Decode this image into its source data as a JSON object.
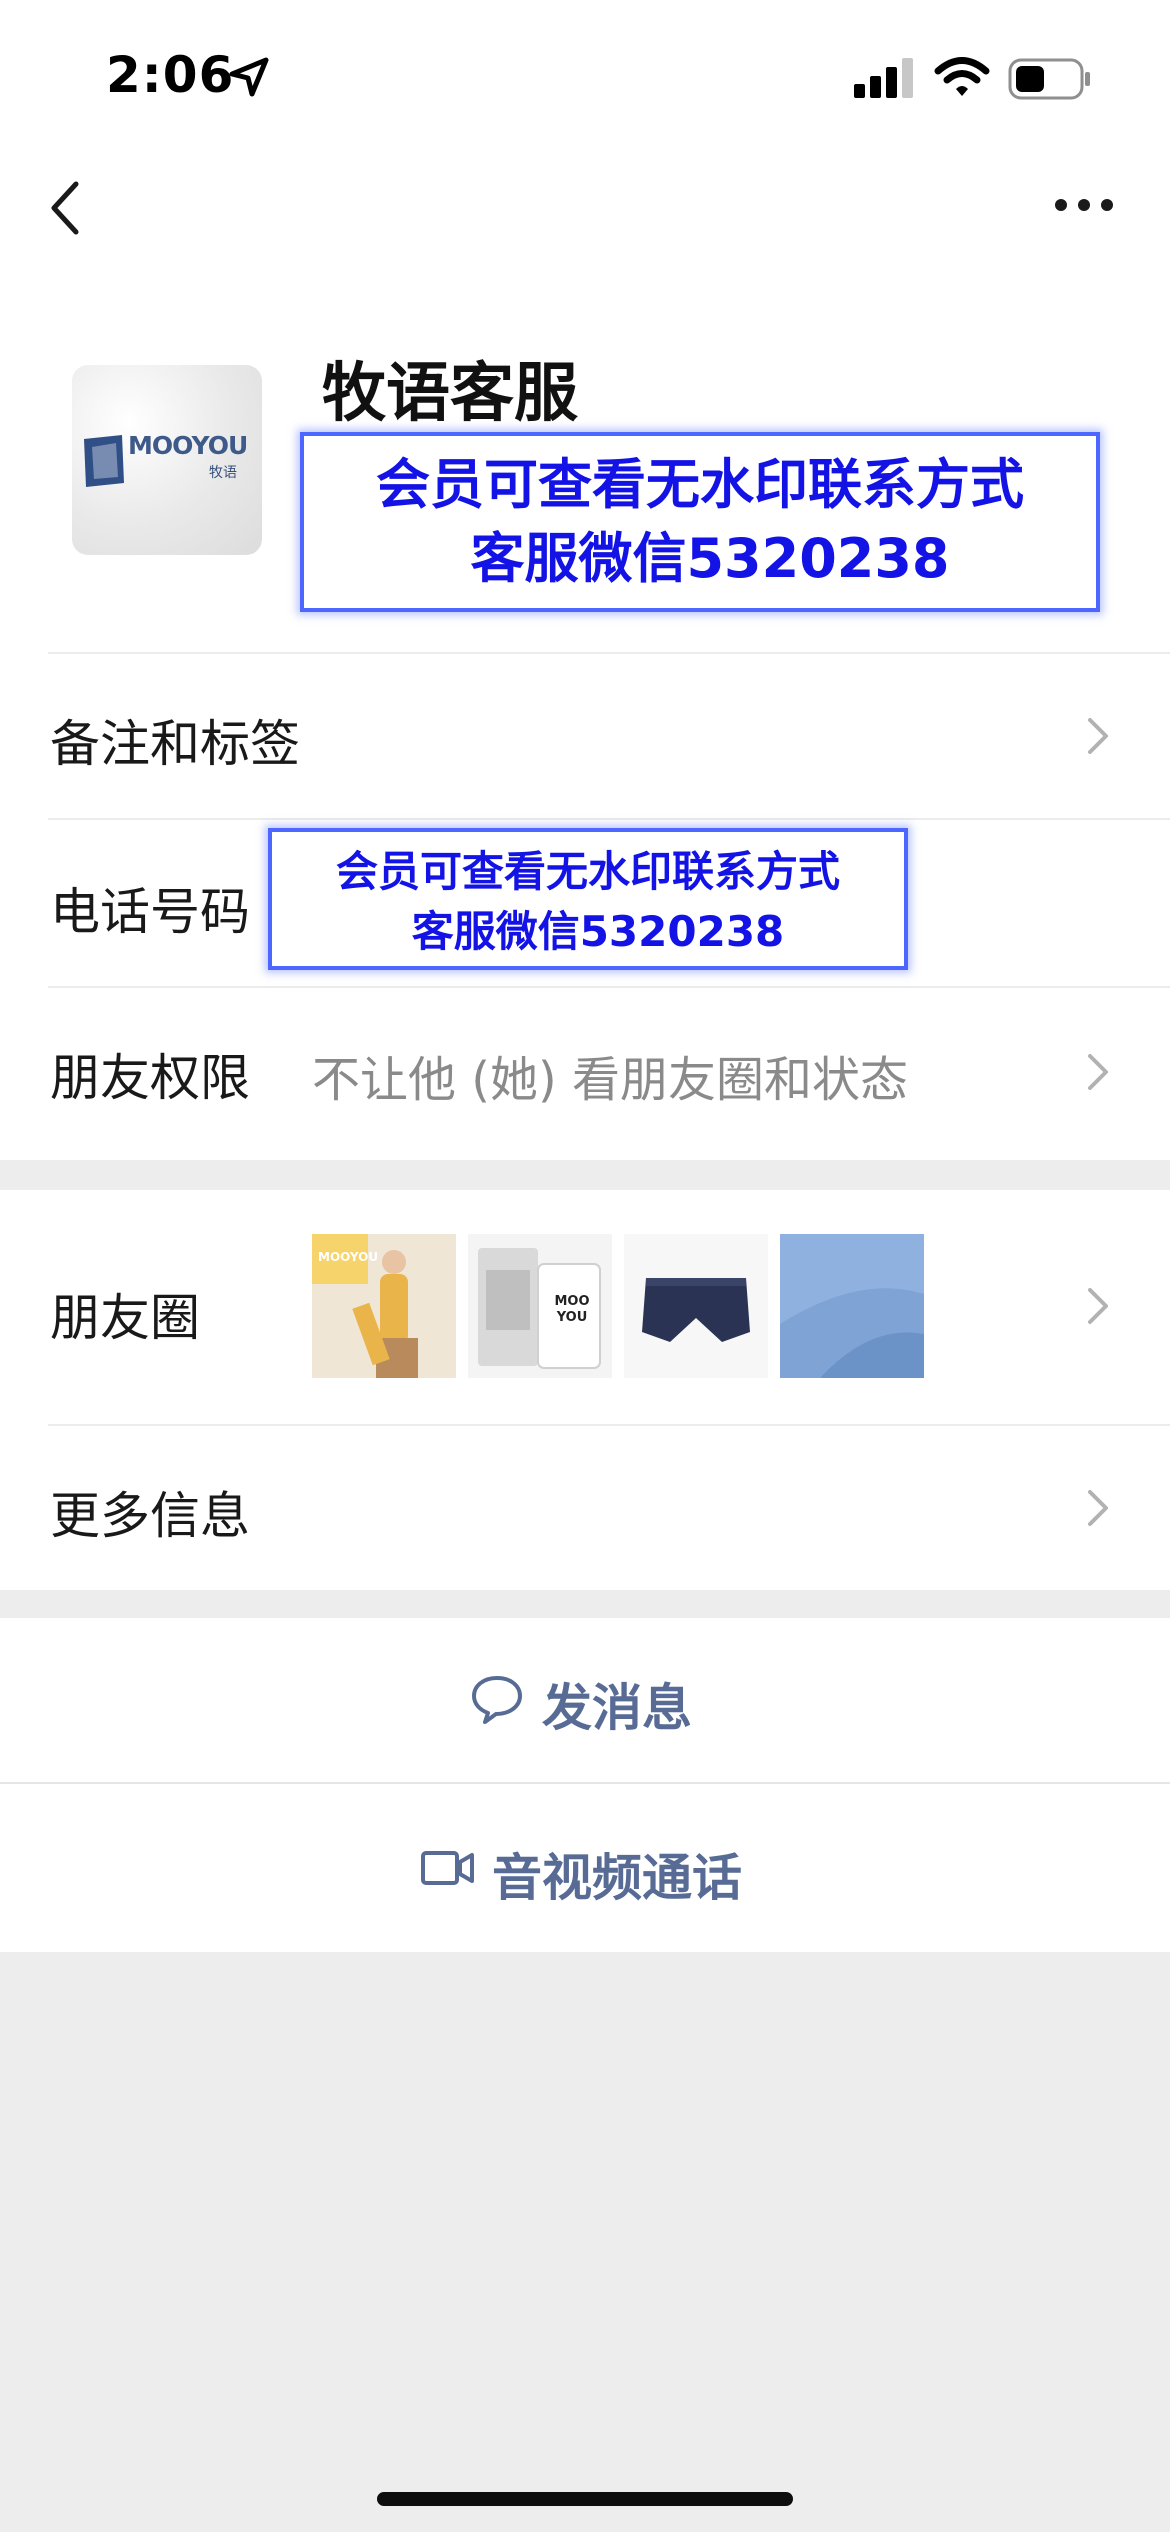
{
  "status_bar": {
    "time": "2:06"
  },
  "profile": {
    "name": "牧语客服",
    "avatar_brand": "MOOYOU",
    "avatar_sub": "牧语",
    "watermark_line1": "会员可查看无水印联系方式",
    "watermark_line2": "客服微信5320238"
  },
  "rows": {
    "remark_label": "备注和标签",
    "phone_label": "电话号码",
    "phone_watermark_line1": "会员可查看无水印联系方式",
    "phone_watermark_line2": "客服微信5320238",
    "permission_label": "朋友权限",
    "permission_value": "不让他 (她) 看朋友圈和状态",
    "moments_label": "朋友圈",
    "more_info_label": "更多信息"
  },
  "moments_thumbs": [
    {
      "caption": "MOOYOU",
      "color": "#f2c94c"
    },
    {
      "caption": "MOO YOU",
      "color": "#eeeeee"
    },
    {
      "caption": "",
      "color": "#2b3354"
    },
    {
      "caption": "",
      "color": "#7ea3d4"
    }
  ],
  "actions": {
    "send_message": "发消息",
    "av_call": "音视频通话"
  },
  "colors": {
    "link_blue": "#576b95",
    "watermark_blue": "#1313e6",
    "background": "#ededed"
  }
}
